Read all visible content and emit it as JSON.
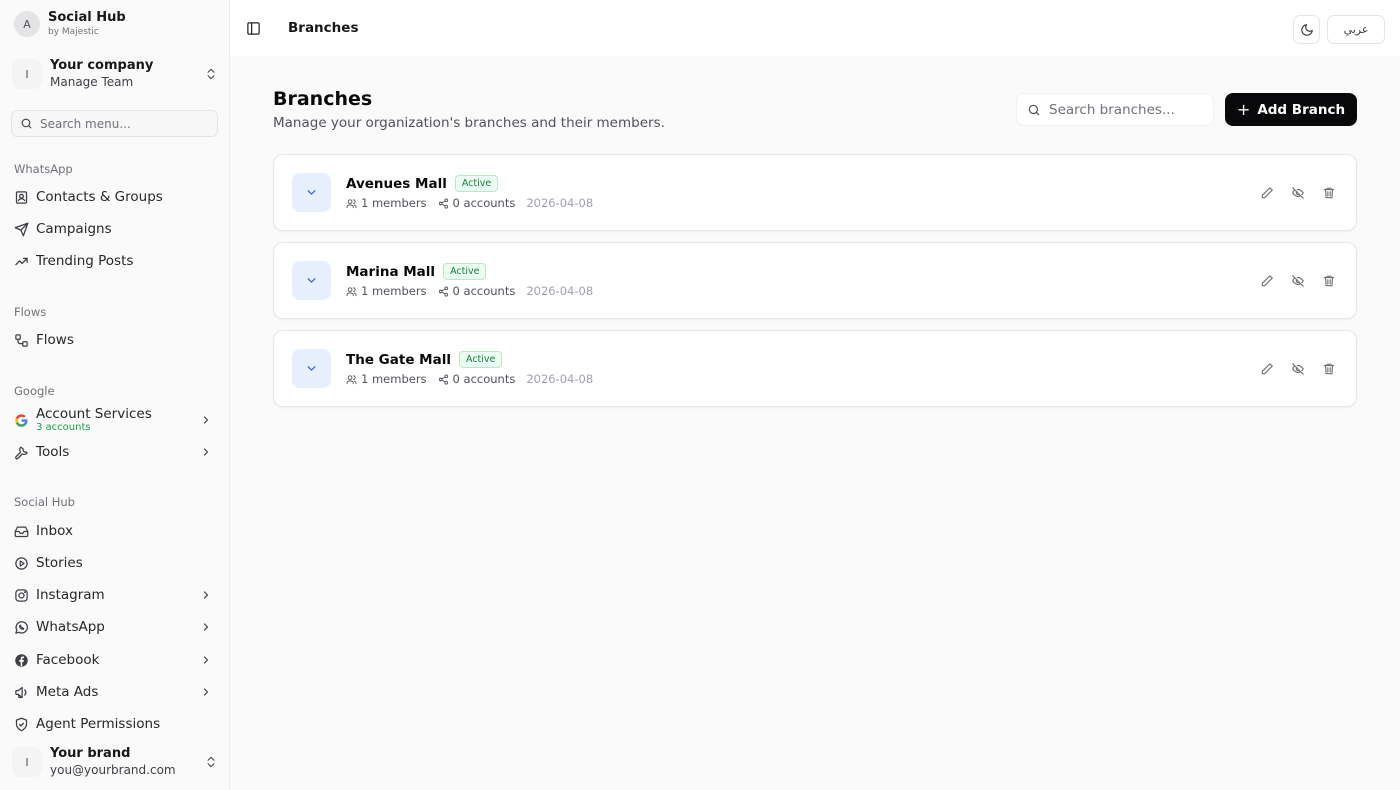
{
  "app": {
    "name": "Social Hub",
    "by": "by Majestic",
    "avatar": "A"
  },
  "company": {
    "initial": "I",
    "name": "Your company",
    "sub": "Manage Team"
  },
  "menu_search": {
    "placeholder": "Search menu..."
  },
  "sidebar": {
    "whatsapp_label": "WhatsApp",
    "contacts": "Contacts & Groups",
    "campaigns": "Campaigns",
    "trending": "Trending Posts",
    "flows_label": "Flows",
    "flows": "Flows",
    "google_label": "Google",
    "account_services": "Account Services",
    "account_services_sub": "3 accounts",
    "tools": "Tools",
    "socialhub_label": "Social Hub",
    "inbox": "Inbox",
    "stories": "Stories",
    "instagram": "Instagram",
    "whatsapp": "WhatsApp",
    "facebook": "Facebook",
    "meta_ads": "Meta Ads",
    "agent_permissions": "Agent Permissions"
  },
  "user": {
    "initial": "I",
    "name": "Your brand",
    "email": "you@yourbrand.com"
  },
  "header": {
    "title": "Branches",
    "lang": "عربي"
  },
  "page": {
    "title": "Branches",
    "subtitle": "Manage your organization's branches and their members.",
    "search_placeholder": "Search branches...",
    "add_label": "Add Branch"
  },
  "branches": [
    {
      "name": "Avenues Mall",
      "status": "Active",
      "members": "1 members",
      "accounts": "0 accounts",
      "date": "2026-04-08"
    },
    {
      "name": "Marina Mall",
      "status": "Active",
      "members": "1 members",
      "accounts": "0 accounts",
      "date": "2026-04-08"
    },
    {
      "name": "The Gate Mall",
      "status": "Active",
      "members": "1 members",
      "accounts": "0 accounts",
      "date": "2026-04-08"
    }
  ],
  "colors": {
    "accent": "#09090b",
    "status_green": "#15803d",
    "expand_blue": "#3b6ee8",
    "sidebar_bg": "#fafafa"
  }
}
